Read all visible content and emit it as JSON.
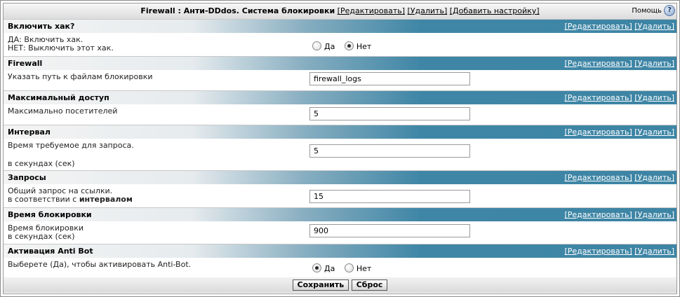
{
  "header": {
    "title": "Firewall : Анти-DDdos. Система блокировки",
    "edit": "[Редактировать]",
    "delete": "[Удалить]",
    "add_setting": "[Добавить настройку]",
    "help_label": "Помощь",
    "help_icon_glyph": "?"
  },
  "section_links": {
    "edit": "[Редактировать]",
    "delete": "[Удалить]"
  },
  "sections": [
    {
      "title": "Включить хак?",
      "desc_line1": "ДА: Включить хак.",
      "desc_line2": "НЕТ: Выключить этот хак.",
      "options": [
        "Да",
        "Нет"
      ],
      "selected": "Нет"
    },
    {
      "title": "Firewall",
      "desc_line1": "Указать путь к файлам блокировки",
      "value": "firewall_logs"
    },
    {
      "title": "Максимальный доступ",
      "desc_line1": "Максимально посетителей",
      "value": "5"
    },
    {
      "title": "Интервал",
      "desc_line1": "Время требуемое для запроса.",
      "desc_line2": "в секундах (сек)",
      "value": "5"
    },
    {
      "title": "Запросы",
      "desc_line1": "Общий запрос на ссылки.",
      "desc_line2_prefix": "в соответствии с ",
      "desc_line2_bold": "интервалом",
      "value": "15"
    },
    {
      "title": "Время блокировки",
      "desc_line1": "Время блокировки",
      "desc_line2": "в секундах (сек)",
      "value": "900"
    },
    {
      "title": "Активация Anti Bot",
      "desc_line1": "Выберете (Да), чтобы активировать Anti-Bot.",
      "options": [
        "Да",
        "Нет"
      ],
      "selected": "Да"
    }
  ],
  "footer": {
    "save": "Сохранить",
    "reset": "Сброс"
  },
  "colors": {
    "header_accent": "#3e85a5",
    "link_on_accent": "#ffffff"
  }
}
